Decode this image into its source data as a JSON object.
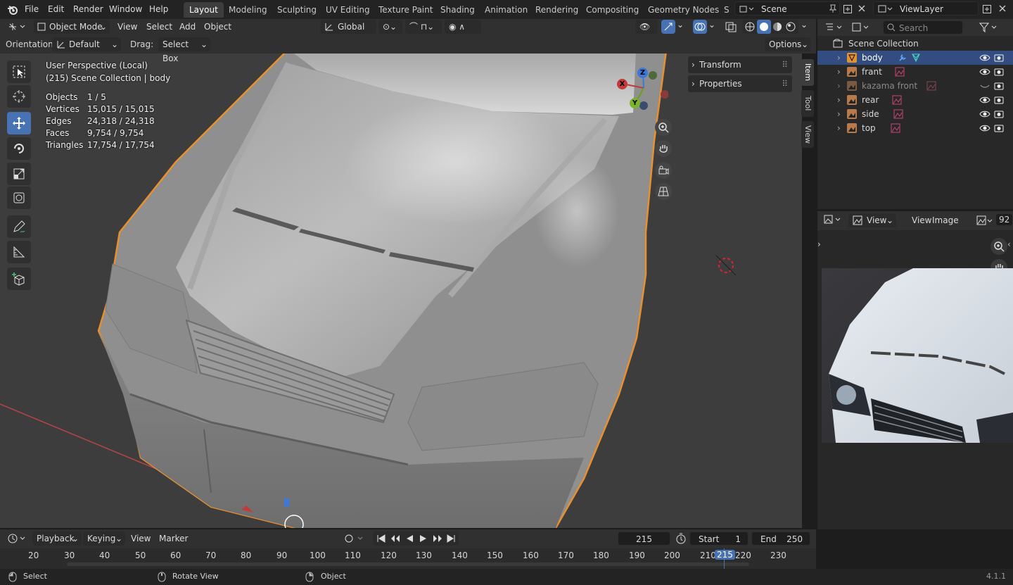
{
  "topbar": {
    "menus": [
      "File",
      "Edit",
      "Render",
      "Window",
      "Help"
    ],
    "workspaces": [
      "Layout",
      "Modeling",
      "Sculpting",
      "UV Editing",
      "Texture Paint",
      "Shading",
      "Animation",
      "Rendering",
      "Compositing",
      "Geometry Nodes",
      "S"
    ],
    "active_workspace": "Layout",
    "scene": "Scene",
    "view_layer": "ViewLayer"
  },
  "viewport_header": {
    "mode": "Object Mode",
    "menus": [
      "View",
      "Select",
      "Add",
      "Object"
    ],
    "transform_orientation": "Global"
  },
  "tool_settings": {
    "orientation_label": "Orientation:",
    "orientation_value": "Default",
    "drag_label": "Drag:",
    "drag_value": "Select Box",
    "options_label": "Options"
  },
  "overlay": {
    "perspective": "User Perspective (Local)",
    "collection": "(215) Scene Collection | body",
    "stats": [
      {
        "label": "Objects",
        "value": "1 / 5"
      },
      {
        "label": "Vertices",
        "value": "15,015 / 15,015"
      },
      {
        "label": "Edges",
        "value": "24,318 / 24,318"
      },
      {
        "label": "Faces",
        "value": "9,754 / 9,754"
      },
      {
        "label": "Triangles",
        "value": "17,754 / 17,754"
      }
    ]
  },
  "gizmo": {
    "x": "X",
    "y": "Y",
    "z": "Z"
  },
  "sidebar": {
    "panels": [
      "Transform",
      "Properties"
    ],
    "tabs": [
      "Item",
      "Tool",
      "View"
    ]
  },
  "outliner": {
    "search_placeholder": "Search",
    "root": "Scene Collection",
    "items": [
      {
        "name": "body",
        "selected": true
      },
      {
        "name": "frant",
        "selected": false
      },
      {
        "name": "kazama front",
        "selected": false,
        "hidden": true
      },
      {
        "name": "rear",
        "selected": false
      },
      {
        "name": "side",
        "selected": false
      },
      {
        "name": "top",
        "selected": false
      }
    ]
  },
  "image_editor": {
    "view_mode": "View",
    "menus": [
      "View",
      "Image"
    ],
    "zoom": "92"
  },
  "timeline": {
    "menus": [
      "Playback",
      "Keying",
      "View",
      "Marker"
    ],
    "current_frame": "215",
    "start_label": "Start",
    "start_value": "1",
    "end_label": "End",
    "end_value": "250",
    "ticks": [
      "20",
      "30",
      "40",
      "50",
      "60",
      "70",
      "80",
      "90",
      "100",
      "110",
      "120",
      "130",
      "140",
      "150",
      "160",
      "170",
      "180",
      "190",
      "200",
      "210",
      "220",
      "230"
    ]
  },
  "statusbar": {
    "select": "Select",
    "rotate": "Rotate View",
    "object": "Object",
    "version": "4.1.1"
  },
  "colors": {
    "accent": "#4772b3",
    "selection_outline": "#e8902f",
    "header": "#303030"
  }
}
